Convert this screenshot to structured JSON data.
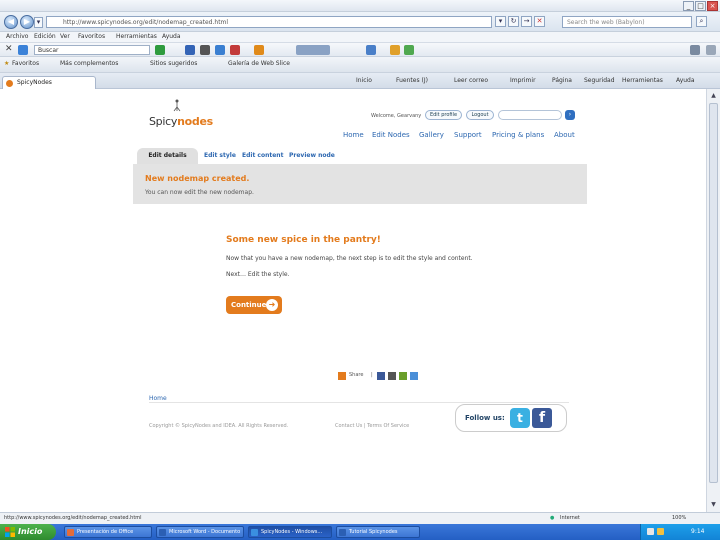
{
  "browser": {
    "url": "http://www.spicynodes.org/edit/nodemap_created.html",
    "search_placeholder": "Search the web (Babylon)",
    "toolbar_search_value": "Buscar",
    "menu": [
      "Archivo",
      "Edición",
      "Ver",
      "Favoritos",
      "Herramientas",
      "Ayuda"
    ],
    "favorites_label": "Favoritos",
    "favorites_items": [
      "Más complementos",
      "Sitios sugeridos",
      "Galería de Web Slice"
    ],
    "tab_label": "SpicyNodes",
    "commands": [
      "Inicio",
      "Fuentes (J)",
      "Leer correo",
      "Imprimir",
      "Página",
      "Seguridad",
      "Herramientas",
      "Ayuda"
    ],
    "window_controls": {
      "minimize": "_",
      "maximize": "□",
      "close": "×"
    }
  },
  "site": {
    "logo_text_1": "Spicy",
    "logo_text_2": "nodes",
    "welcome": "Welcome, Gearvany",
    "edit_profile": "Edit profile",
    "logout": "Logout",
    "nav": [
      "Home",
      "Edit Nodes",
      "Gallery",
      "Support",
      "Pricing & plans",
      "About"
    ],
    "subtabs": [
      "Edit details",
      "Edit style",
      "Edit content",
      "Preview node"
    ],
    "notice_title": "New nodemap created.",
    "notice_sub": "You can now edit the new nodemap.",
    "heading": "Some new spice in the pantry!",
    "paragraph": "Now that you have a new nodemap, the next step is to edit the style and content.",
    "next": "Next… Edit the style.",
    "continue_label": "Continue",
    "share_label": "Share",
    "home_link": "Home",
    "copyright": "Copyright © SpicyNodes and IDEA. All Rights Reserved.",
    "terms": "Contact Us | Terms Of Service",
    "follow_label": "Follow us:"
  },
  "status": {
    "url_text": "http://www.spicynodes.org/edit/nodemap_created.html",
    "zone": "Internet",
    "zoom": "100%"
  },
  "taskbar": {
    "start": "Inicio",
    "items": [
      "Presentación de Office",
      "Microsoft Word - Documento",
      "SpicyNodes - Windows...",
      "Tutorial Spicynodes"
    ],
    "clock": "9:14"
  }
}
